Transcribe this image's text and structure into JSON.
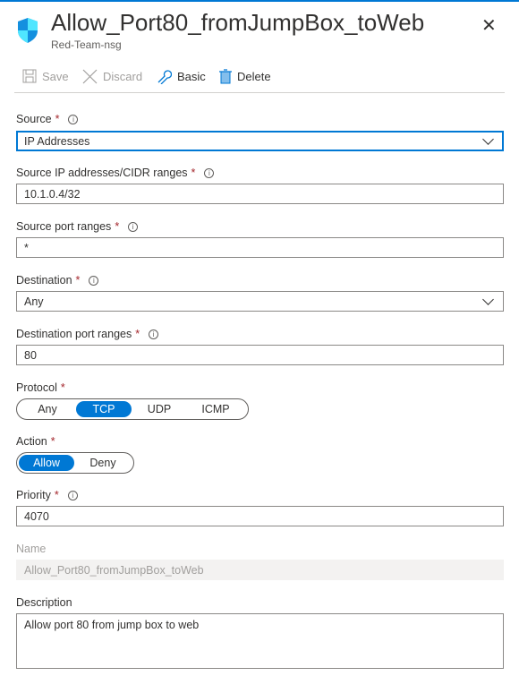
{
  "header": {
    "title": "Allow_Port80_fromJumpBox_toWeb",
    "subtitle": "Red-Team-nsg",
    "icon": "shield-icon",
    "close_icon": "close-icon"
  },
  "toolbar": {
    "save": "Save",
    "discard": "Discard",
    "basic": "Basic",
    "delete": "Delete"
  },
  "form": {
    "source": {
      "label": "Source",
      "value": "IP Addresses"
    },
    "source_ip": {
      "label": "Source IP addresses/CIDR ranges",
      "value": "10.1.0.4/32"
    },
    "source_port": {
      "label": "Source port ranges",
      "value": "*"
    },
    "destination": {
      "label": "Destination",
      "value": "Any"
    },
    "dest_port": {
      "label": "Destination port ranges",
      "value": "80"
    },
    "protocol": {
      "label": "Protocol",
      "options": [
        "Any",
        "TCP",
        "UDP",
        "ICMP"
      ],
      "selected": "TCP"
    },
    "action": {
      "label": "Action",
      "options": [
        "Allow",
        "Deny"
      ],
      "selected": "Allow"
    },
    "priority": {
      "label": "Priority",
      "value": "4070"
    },
    "name": {
      "label": "Name",
      "value": "Allow_Port80_fromJumpBox_toWeb"
    },
    "description": {
      "label": "Description",
      "value": "Allow port 80 from jump box to web"
    }
  },
  "required_mark": "*",
  "colors": {
    "accent": "#0078d4",
    "required": "#a4262c"
  }
}
